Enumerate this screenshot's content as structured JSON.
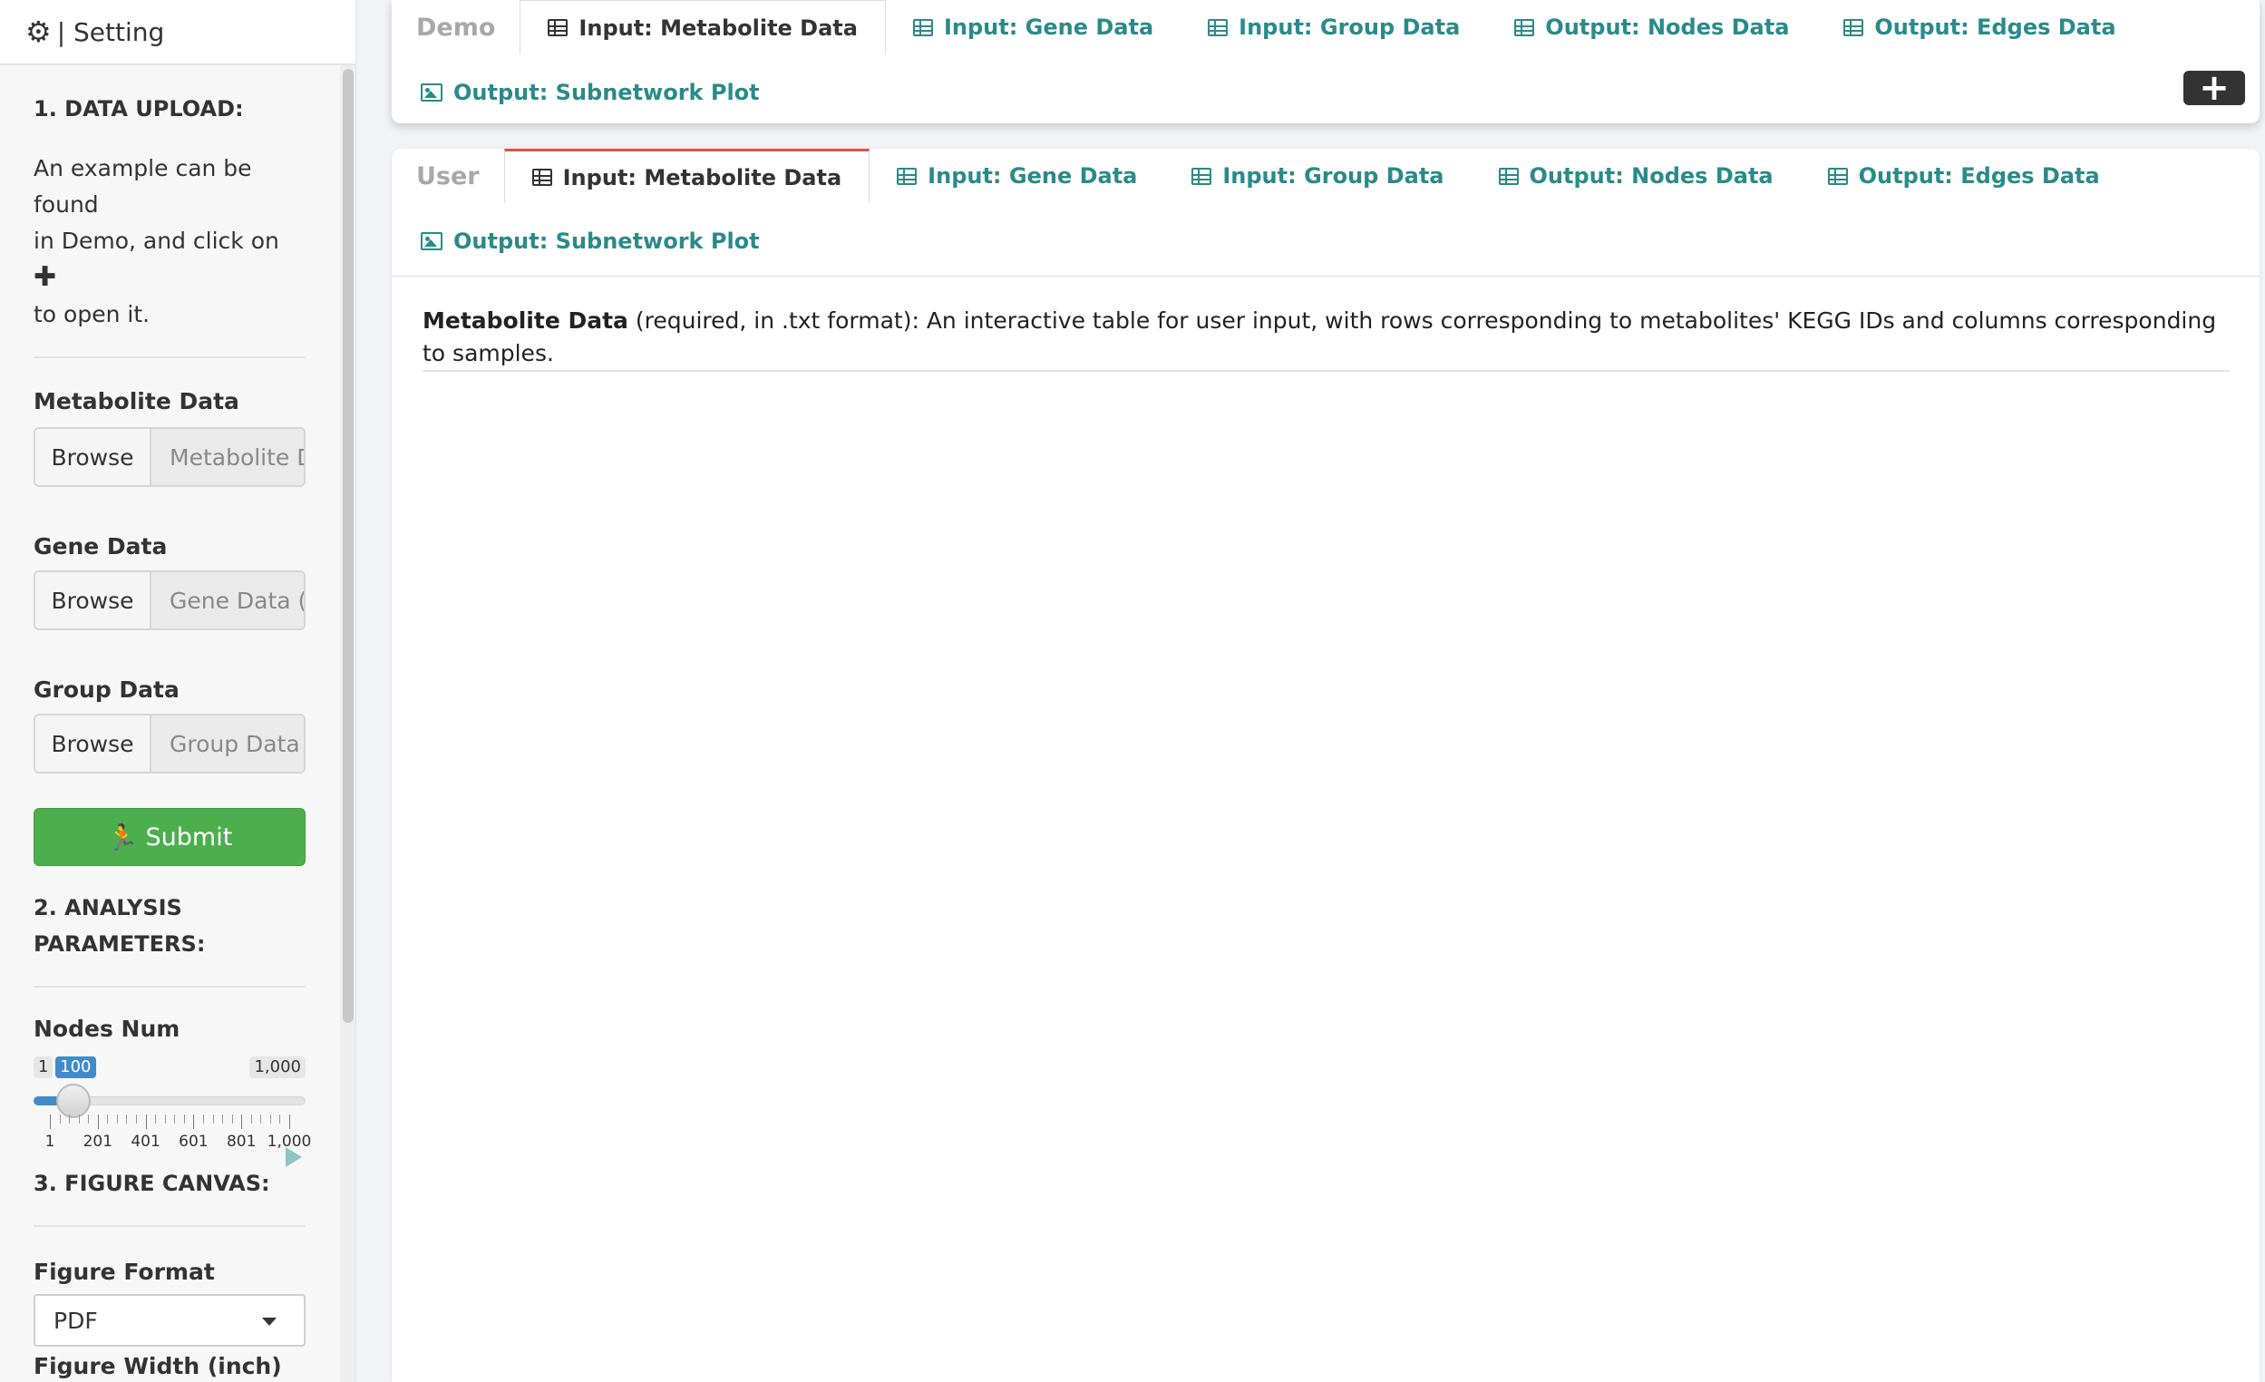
{
  "sidebar": {
    "header": {
      "title": "| Setting"
    },
    "section1": {
      "title": "1. DATA UPLOAD:"
    },
    "example_text_1": "An example can be found",
    "example_text_2": "in Demo, and click on",
    "example_text_3": "to open it.",
    "metabolite": {
      "label": "Metabolite Data",
      "browse": "Browse",
      "placeholder": "Metabolite Data"
    },
    "gene": {
      "label": "Gene Data",
      "browse": "Browse",
      "placeholder": "Gene Data ("
    },
    "group": {
      "label": "Group Data",
      "browse": "Browse",
      "placeholder": "Group Data"
    },
    "submit_label": "Submit",
    "section2": {
      "title_line1": "2. ANALYSIS",
      "title_line2": "PARAMETERS:"
    },
    "nodes_num": {
      "label": "Nodes Num",
      "min": 1,
      "max": 1000,
      "value": 100,
      "min_label": "1",
      "max_label": "1,000",
      "value_label": "100",
      "tick_labels": [
        "1",
        "201",
        "401",
        "601",
        "801",
        "1,000"
      ]
    },
    "section3": {
      "title": "3. FIGURE CANVAS:"
    },
    "figure_format": {
      "label": "Figure Format",
      "value": "PDF"
    },
    "figure_width": {
      "label": "Figure Width (inch)"
    }
  },
  "demo_panel": {
    "title": "Demo",
    "tabs": [
      {
        "label": "Input: Metabolite Data",
        "icon": "table-icon",
        "active": true
      },
      {
        "label": "Input: Gene Data",
        "icon": "table-icon",
        "active": false
      },
      {
        "label": "Input: Group Data",
        "icon": "table-icon",
        "active": false
      },
      {
        "label": "Output: Nodes Data",
        "icon": "table-icon",
        "active": false
      },
      {
        "label": "Output: Edges Data",
        "icon": "table-icon",
        "active": false
      },
      {
        "label": "Output: Subnetwork Plot",
        "icon": "image-icon",
        "active": false
      }
    ],
    "expand_icon": "plus-icon"
  },
  "user_panel": {
    "title": "User",
    "tabs": [
      {
        "label": "Input: Metabolite Data",
        "icon": "table-icon",
        "active": true
      },
      {
        "label": "Input: Gene Data",
        "icon": "table-icon",
        "active": false
      },
      {
        "label": "Input: Group Data",
        "icon": "table-icon",
        "active": false
      },
      {
        "label": "Output: Nodes Data",
        "icon": "table-icon",
        "active": false
      },
      {
        "label": "Output: Edges Data",
        "icon": "table-icon",
        "active": false
      },
      {
        "label": "Output: Subnetwork Plot",
        "icon": "image-icon",
        "active": false
      }
    ],
    "content": {
      "bold": "Metabolite Data",
      "text": " (required, in .txt format): An interactive table for user input, with rows corresponding to metabolites' KEGG IDs and columns corresponding to samples."
    }
  },
  "colors": {
    "accent_teal": "#2a8a8a",
    "active_tab_border": "#d9534f",
    "submit_green": "#4cae4c",
    "slider_blue": "#428bca"
  }
}
